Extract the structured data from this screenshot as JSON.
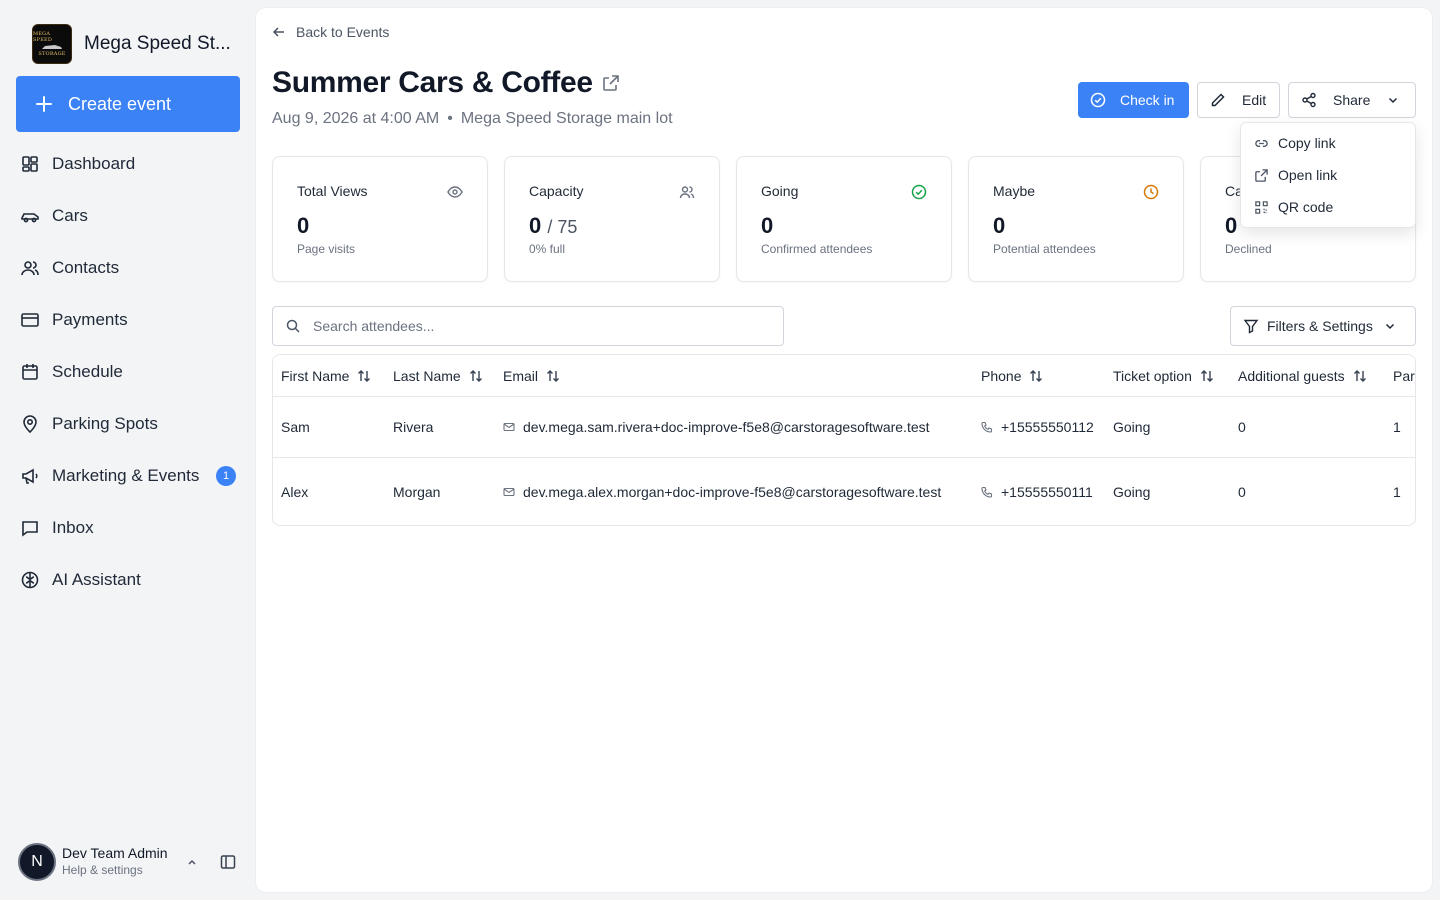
{
  "brand": {
    "name": "Mega Speed St...",
    "logo_lines": [
      "MEGA SPEED",
      "STORAGE"
    ]
  },
  "sidebar": {
    "create_label": "Create event",
    "items": [
      {
        "label": "Dashboard",
        "icon": "dashboard-icon"
      },
      {
        "label": "Cars",
        "icon": "car-icon"
      },
      {
        "label": "Contacts",
        "icon": "contacts-icon"
      },
      {
        "label": "Payments",
        "icon": "credit-card-icon"
      },
      {
        "label": "Schedule",
        "icon": "calendar-icon"
      },
      {
        "label": "Parking Spots",
        "icon": "map-pin-icon"
      },
      {
        "label": "Marketing & Events",
        "icon": "megaphone-icon",
        "badge": "1"
      },
      {
        "label": "Inbox",
        "icon": "message-icon"
      },
      {
        "label": "AI Assistant",
        "icon": "brain-icon"
      }
    ]
  },
  "user": {
    "initial": "N",
    "name": "Dev Team Admin",
    "sub": "Help & settings"
  },
  "event": {
    "back_label": "Back to Events",
    "title": "Summer Cars & Coffee",
    "date": "Aug 9, 2026 at 4:00 AM",
    "location": "Mega Speed Storage main lot"
  },
  "actions": {
    "checkin": "Check in",
    "edit": "Edit",
    "share": "Share"
  },
  "share_menu": [
    {
      "label": "Copy link",
      "icon": "link-icon"
    },
    {
      "label": "Open link",
      "icon": "external-link-icon"
    },
    {
      "label": "QR code",
      "icon": "qr-code-icon"
    }
  ],
  "stats": [
    {
      "label": "Total Views",
      "value": "0",
      "sub": "Page visits",
      "icon": "eye-icon",
      "color": "#6b7280"
    },
    {
      "label": "Capacity",
      "value": "0",
      "of": "/ 75",
      "sub": "0% full",
      "icon": "users-icon",
      "color": "#6b7280"
    },
    {
      "label": "Going",
      "value": "0",
      "sub": "Confirmed attendees",
      "icon": "check-circle-icon",
      "color": "#16a34a"
    },
    {
      "label": "Maybe",
      "value": "0",
      "sub": "Potential attendees",
      "icon": "clock-icon",
      "color": "#d97706"
    },
    {
      "label": "Ca",
      "value": "0",
      "sub": "Declined",
      "icon": "x-circle-icon",
      "color": "#dc2626"
    }
  ],
  "search": {
    "placeholder": "Search attendees..."
  },
  "filters": {
    "label": "Filters & Settings"
  },
  "table": {
    "columns": [
      "First Name",
      "Last Name",
      "Email",
      "Phone",
      "Ticket option",
      "Additional guests",
      "Par"
    ],
    "rows": [
      {
        "first": "Sam",
        "last": "Rivera",
        "email": "dev.mega.sam.rivera+doc-improve-f5e8@carstoragesoftware.test",
        "phone": "+15555550112",
        "ticket": "Going",
        "guests": "0",
        "party": "1"
      },
      {
        "first": "Alex",
        "last": "Morgan",
        "email": "dev.mega.alex.morgan+doc-improve-f5e8@carstoragesoftware.test",
        "phone": "+15555550111",
        "ticket": "Going",
        "guests": "0",
        "party": "1"
      }
    ]
  }
}
